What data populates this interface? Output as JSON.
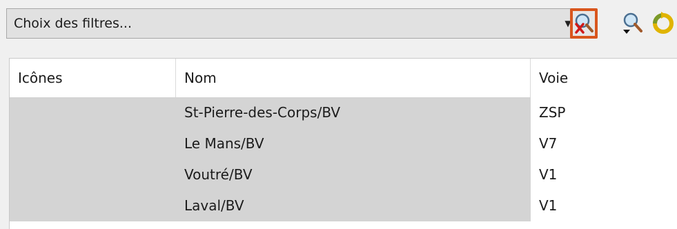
{
  "filter_bar": {
    "combo_value": "Choix des filtres...",
    "clear_filter_icon": "search-clear-icon",
    "filter_dropdown_icon": "search-dropdown-icon",
    "refresh_icon": "refresh-icon",
    "highlight_color": "#d9561d"
  },
  "grid": {
    "columns": [
      "Icônes",
      "Nom",
      "Voie"
    ],
    "rows": [
      {
        "icon": "",
        "name": "St-Pierre-des-Corps/BV",
        "track": "ZSP"
      },
      {
        "icon": "",
        "name": "Le Mans/BV",
        "track": "V7"
      },
      {
        "icon": "",
        "name": "Voutré/BV",
        "track": "V1"
      },
      {
        "icon": "",
        "name": "Laval/BV",
        "track": "V1"
      }
    ]
  }
}
